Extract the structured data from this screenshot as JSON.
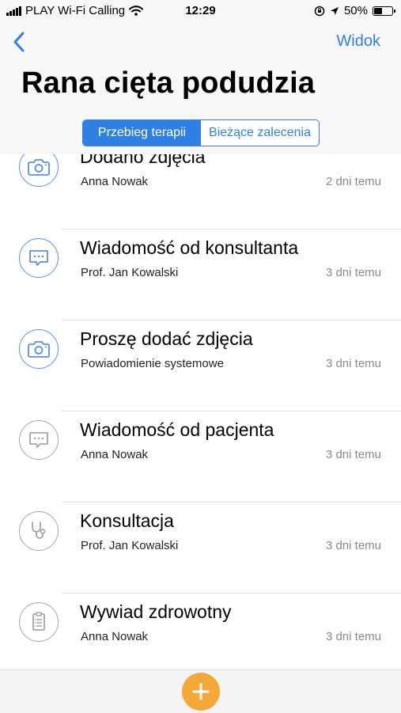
{
  "status_bar": {
    "carrier": "PLAY Wi-Fi Calling",
    "time": "12:29",
    "battery": "50%",
    "battery_level": 0.5
  },
  "nav": {
    "back_icon": "chevron-left-icon",
    "right_label": "Widok",
    "title": "Rana cięta podudzia"
  },
  "segment": {
    "active_label": "Przebieg terapii",
    "inactive_label": "Bieżące zalecenia"
  },
  "colors": {
    "accent": "#2f80e2",
    "active_icon": "#5b8fe6",
    "inactive_icon": "#a6a6a6",
    "fab": "#f4a83a"
  },
  "items": [
    {
      "title": "Dodano zdjęcia",
      "subtitle": "Anna Nowak",
      "time": "2 dni temu",
      "icon": "camera-icon",
      "active": true
    },
    {
      "title": "Wiadomość od konsultanta",
      "subtitle": "Prof. Jan Kowalski",
      "time": "3 dni temu",
      "icon": "message-icon",
      "active": true
    },
    {
      "title": "Proszę dodać zdjęcia",
      "subtitle": "Powiadomienie systemowe",
      "time": "3 dni temu",
      "icon": "camera-icon",
      "active": true
    },
    {
      "title": "Wiadomość od pacjenta",
      "subtitle": "Anna Nowak",
      "time": "3 dni temu",
      "icon": "message-icon",
      "active": false
    },
    {
      "title": "Konsultacja",
      "subtitle": "Prof. Jan Kowalski",
      "time": "3 dni temu",
      "icon": "stethoscope-icon",
      "active": false
    },
    {
      "title": "Wywiad zdrowotny",
      "subtitle": "Anna Nowak",
      "time": "3 dni temu",
      "icon": "clipboard-icon",
      "active": false
    }
  ],
  "fab_icon": "plus-icon"
}
